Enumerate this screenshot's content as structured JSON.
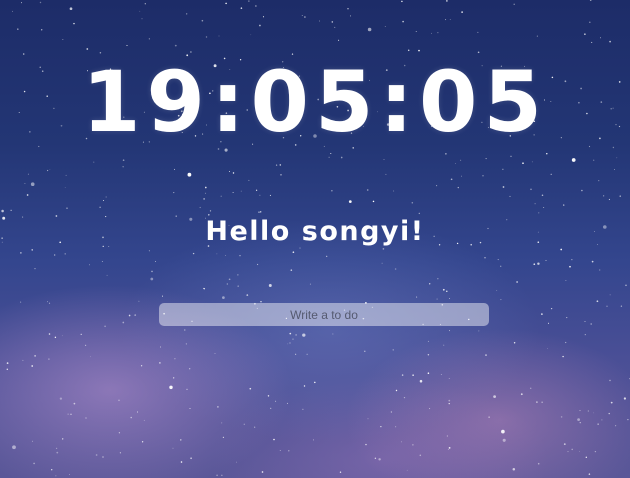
{
  "clock": {
    "time": "19:05:05"
  },
  "greeting": {
    "text": "Hello songyi!"
  },
  "todo": {
    "placeholder": "Write a to do",
    "value": ""
  },
  "colors": {
    "sky_top": "#1d2c68",
    "sky_bottom": "#5a5798",
    "text": "#ffffff",
    "input_bg": "rgba(255,255,255,0.45)"
  }
}
